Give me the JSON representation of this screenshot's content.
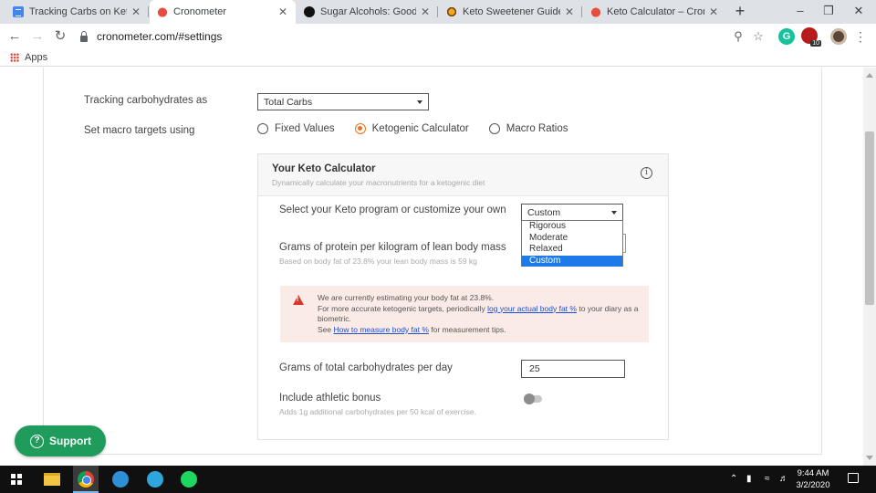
{
  "browser": {
    "tabs": [
      {
        "title": "Tracking Carbs on Keto Upd",
        "favicon": "docs-icon",
        "active": false
      },
      {
        "title": "Cronometer",
        "favicon": "cronometer-icon",
        "active": true
      },
      {
        "title": "Sugar Alcohols: Good or Ba",
        "favicon": "sugar-site-icon",
        "active": false
      },
      {
        "title": "Keto Sweetener Guide: Best",
        "favicon": "keto-site-icon",
        "active": false
      },
      {
        "title": "Keto Calculator – Cronomet",
        "favicon": "cronometer-icon",
        "active": false
      }
    ],
    "tab_close_glyph": "✕",
    "new_tab_glyph": "+",
    "url": "cronometer.com/#settings",
    "bookmarks_apps_label": "Apps",
    "extension_badge": "10"
  },
  "settings": {
    "tracking_label": "Tracking carbohydrates as",
    "tracking_value": "Total Carbs",
    "macro_label": "Set macro targets using",
    "macro_options": [
      {
        "label": "Fixed Values",
        "checked": false
      },
      {
        "label": "Ketogenic Calculator",
        "checked": true
      },
      {
        "label": "Macro Ratios",
        "checked": false
      }
    ]
  },
  "keto": {
    "title": "Your Keto Calculator",
    "subtitle": "Dynamically calculate your macronutrients for a ketogenic diet",
    "info_glyph": "i",
    "program_label": "Select your Keto program or customize your own",
    "program_value": "Custom",
    "program_options": [
      {
        "label": "Rigorous",
        "selected": false
      },
      {
        "label": "Moderate",
        "selected": false
      },
      {
        "label": "Relaxed",
        "selected": false
      },
      {
        "label": "Custom",
        "selected": true
      }
    ],
    "protein_label": "Grams of protein per kilogram of lean body mass",
    "protein_note": "Based on body fat of 23.8% your lean body mass is 59 kg",
    "warning": {
      "line1": "We are currently estimating your body fat at 23.8%.",
      "line2_pre": "For more accurate ketogenic targets, periodically ",
      "line2_link": "log your actual body fat %",
      "line2_post": " to your diary as a biometric.",
      "line3_pre": "See ",
      "line3_link": "How to measure body fat %",
      "line3_post": " for measurement tips."
    },
    "carbs_label": "Grams of total carbohydrates per day",
    "carbs_value": "25",
    "athletic_label": "Include athletic bonus",
    "athletic_note": "Adds 1g additional carbohydrates per 50 kcal of exercise.",
    "athletic_enabled": false
  },
  "support": {
    "label": "Support",
    "glyph": "?"
  },
  "taskbar": {
    "time": "9:44 AM",
    "date": "3/2/2020"
  },
  "colors": {
    "accent": "#f26f21",
    "support_green": "#1f9c5b",
    "link_blue": "#1a4fd6",
    "dropdown_selected": "#1e7ae8",
    "warning_red": "#d9362b"
  }
}
